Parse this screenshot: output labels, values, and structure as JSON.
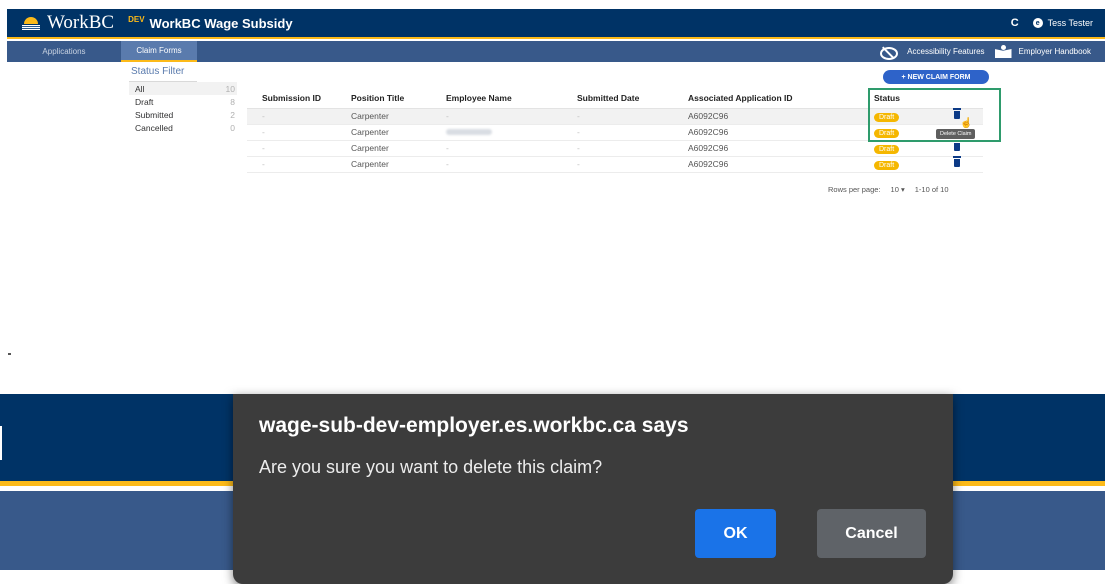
{
  "header": {
    "logo_text": "WorkBC",
    "env_badge": "DEV",
    "app_title": "WorkBC Wage Subsidy",
    "refresh_icon": "C",
    "user_icon": "e",
    "user_name": "Tess Tester"
  },
  "nav": {
    "tabs": [
      "Applications",
      "Claim Forms"
    ],
    "active_tab": "Claim Forms",
    "accessibility": "Accessibility Features",
    "handbook": "Employer Handbook"
  },
  "status_filter": {
    "title": "Status Filter",
    "items": [
      {
        "label": "All",
        "count": "10"
      },
      {
        "label": "Draft",
        "count": "8"
      },
      {
        "label": "Submitted",
        "count": "2"
      },
      {
        "label": "Cancelled",
        "count": "0"
      }
    ]
  },
  "toolbar": {
    "new_claim_label": "+  NEW CLAIM FORM"
  },
  "table": {
    "columns": [
      "Submission ID",
      "Position Title",
      "Employee Name",
      "Submitted Date",
      "Associated Application ID",
      "Status"
    ],
    "rows": [
      {
        "submission_id": "-",
        "position": "Carpenter",
        "employee": "-",
        "submitted": "-",
        "app_id": "A6092C96",
        "status": "Draft"
      },
      {
        "submission_id": "-",
        "position": "Carpenter",
        "employee": "",
        "submitted": "-",
        "app_id": "A6092C96",
        "status": "Draft"
      },
      {
        "submission_id": "-",
        "position": "Carpenter",
        "employee": "-",
        "submitted": "-",
        "app_id": "A6092C96",
        "status": "Draft"
      },
      {
        "submission_id": "-",
        "position": "Carpenter",
        "employee": "-",
        "submitted": "-",
        "app_id": "A6092C96",
        "status": "Draft"
      }
    ],
    "tooltip": "Delete Claim"
  },
  "pagination": {
    "rows_per_page_label": "Rows per page:",
    "rows_per_page_value": "10 ▾",
    "range": "1-10 of 10"
  },
  "dialog": {
    "origin": "wage-sub-dev-employer.es.workbc.ca says",
    "message": "Are you sure you want to delete this claim?",
    "ok_label": "OK",
    "cancel_label": "Cancel"
  },
  "colors": {
    "header_bg": "#003366",
    "nav_bg": "#38598a",
    "accent_gold": "#fcba19",
    "draft_badge": "#f5b700",
    "primary_button": "#2e63c9",
    "dialog_bg": "#3c3c3c",
    "ok_button": "#1a73e8",
    "cancel_button": "#5f6368",
    "highlight_border": "#2e9b6c"
  },
  "icons": {
    "logo": "bc-sun-logo-icon",
    "refresh": "refresh-icon",
    "user": "user-circle-icon",
    "accessibility": "eye-slash-icon",
    "handbook": "reader-book-icon",
    "delete": "trash-icon",
    "cursor": "hand-pointer-icon"
  }
}
